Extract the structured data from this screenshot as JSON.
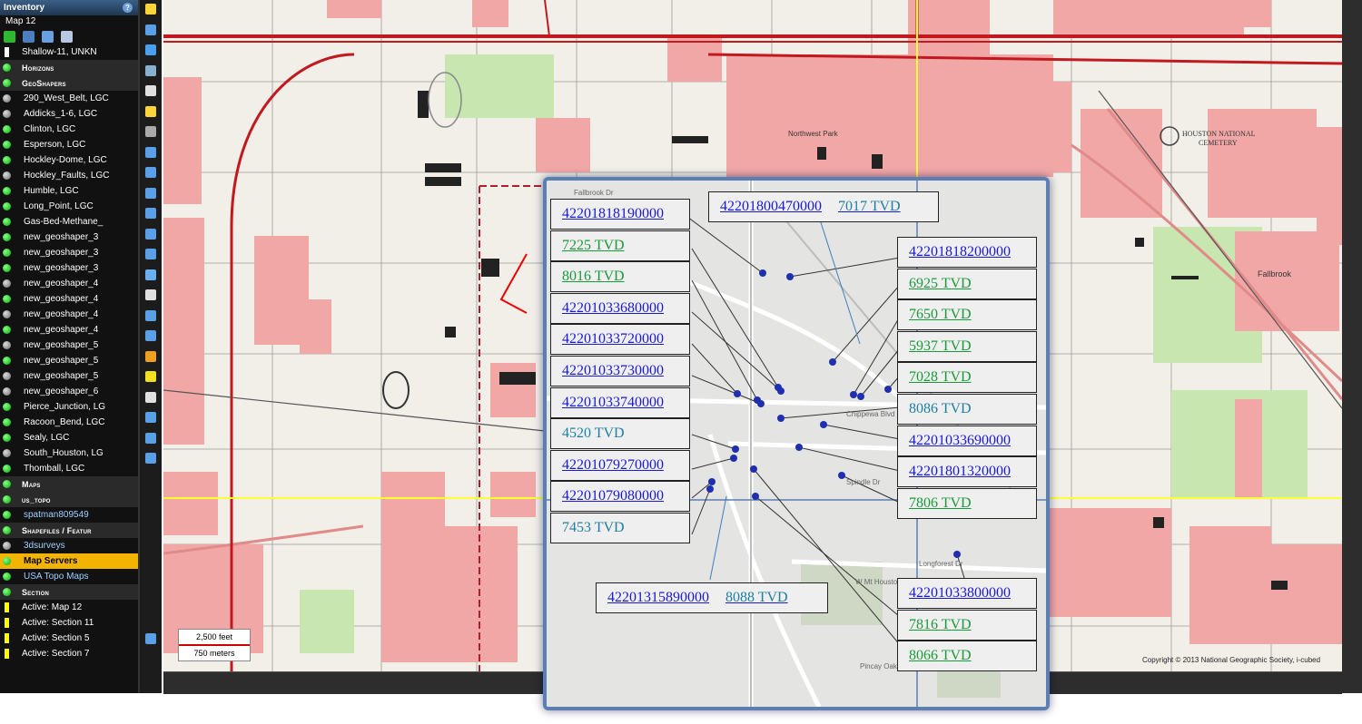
{
  "panel": {
    "title": "Inventory",
    "help_icon": "?",
    "map_name": "Map 12",
    "layers": [
      {
        "label": "Shallow-11, UNKN",
        "type": "item",
        "icon": "white"
      },
      {
        "label": "Horizons",
        "type": "group"
      },
      {
        "label": "GeoShapers",
        "type": "group"
      },
      {
        "label": "290_West_Belt, LGC",
        "type": "item",
        "icon": "gray"
      },
      {
        "label": "Addicks_1-6, LGC",
        "type": "item",
        "icon": "gray"
      },
      {
        "label": "Clinton, LGC",
        "type": "item",
        "icon": "green"
      },
      {
        "label": "Esperson, LGC",
        "type": "item",
        "icon": "green"
      },
      {
        "label": "Hockley-Dome, LGC",
        "type": "item",
        "icon": "green"
      },
      {
        "label": "Hockley_Faults, LGC",
        "type": "item",
        "icon": "gray"
      },
      {
        "label": "Humble, LGC",
        "type": "item",
        "icon": "green"
      },
      {
        "label": "Long_Point, LGC",
        "type": "item",
        "icon": "green"
      },
      {
        "label": "Gas-Bed-Methane_",
        "type": "item",
        "icon": "green"
      },
      {
        "label": "new_geoshaper_3",
        "type": "item",
        "icon": "green"
      },
      {
        "label": "new_geoshaper_3",
        "type": "item",
        "icon": "green"
      },
      {
        "label": "new_geoshaper_3",
        "type": "item",
        "icon": "green"
      },
      {
        "label": "new_geoshaper_4",
        "type": "item",
        "icon": "gray"
      },
      {
        "label": "new_geoshaper_4",
        "type": "item",
        "icon": "green"
      },
      {
        "label": "new_geoshaper_4",
        "type": "item",
        "icon": "gray"
      },
      {
        "label": "new_geoshaper_4",
        "type": "item",
        "icon": "green"
      },
      {
        "label": "new_geoshaper_5",
        "type": "item",
        "icon": "gray"
      },
      {
        "label": "new_geoshaper_5",
        "type": "item",
        "icon": "green"
      },
      {
        "label": "new_geoshaper_5",
        "type": "item",
        "icon": "gray"
      },
      {
        "label": "new_geoshaper_6",
        "type": "item",
        "icon": "gray"
      },
      {
        "label": "Pierce_Junction, LG",
        "type": "item",
        "icon": "green"
      },
      {
        "label": "Racoon_Bend, LGC",
        "type": "item",
        "icon": "green"
      },
      {
        "label": "Sealy, LGC",
        "type": "item",
        "icon": "green"
      },
      {
        "label": "South_Houston, LG",
        "type": "item",
        "icon": "gray"
      },
      {
        "label": "Thomball, LGC",
        "type": "item",
        "icon": "green"
      },
      {
        "label": "Maps",
        "type": "group"
      },
      {
        "label": "us_topo",
        "type": "group"
      },
      {
        "label": "spatman809549",
        "type": "link",
        "icon": "green"
      },
      {
        "label": "Shapefiles / Featur",
        "type": "group"
      },
      {
        "label": "3dsurveys",
        "type": "link",
        "icon": "gray"
      },
      {
        "label": "Map Servers",
        "type": "selected"
      },
      {
        "label": "USA Topo Maps",
        "type": "link",
        "icon": "green"
      },
      {
        "label": "Section",
        "type": "group"
      },
      {
        "label": "Active: Map 12",
        "type": "item",
        "icon": "yellow"
      },
      {
        "label": "Active: Section 11",
        "type": "item",
        "icon": "yellow"
      },
      {
        "label": "Active: Section 5",
        "type": "item",
        "icon": "yellow"
      },
      {
        "label": "Active: Section 7",
        "type": "item",
        "icon": "yellow"
      }
    ]
  },
  "map": {
    "labels": {
      "cemetery_1": "HOUSTON NATIONAL",
      "cemetery_2": "CEMETERY",
      "park": "Northwest Park",
      "fallbrook": "Fallbrook"
    },
    "scale": {
      "feet": "2,500 feet",
      "meters": "750 meters"
    },
    "copyright": "Copyright © 2013 National Geographic Society, i-cubed"
  },
  "inset": {
    "streets": [
      "Fallbrook Dr",
      "Chippewa Blvd",
      "Spindle Dr",
      "Longforest Dr",
      "W Mt Houston Rd",
      "Pincay Oaks"
    ],
    "left_boxes": [
      {
        "text": "42201818190000",
        "style": "api"
      },
      {
        "text": "7225  TVD",
        "style": "tvdg"
      },
      {
        "text": "8016  TVD",
        "style": "tvdg"
      },
      {
        "text": "42201033680000",
        "style": "api"
      },
      {
        "text": "42201033720000",
        "style": "api"
      },
      {
        "text": "42201033730000",
        "style": "api"
      },
      {
        "text": "42201033740000",
        "style": "api"
      },
      {
        "text": "4520  TVD",
        "style": "tvdt"
      },
      {
        "text": "42201079270000",
        "style": "api"
      },
      {
        "text": "42201079080000",
        "style": "api"
      },
      {
        "text": "7453  TVD",
        "style": "tvdt"
      }
    ],
    "right_boxes": [
      {
        "text": "42201818200000",
        "style": "api"
      },
      {
        "text": "6925  TVD",
        "style": "tvdg"
      },
      {
        "text": "7650  TVD",
        "style": "tvdg"
      },
      {
        "text": "5937  TVD",
        "style": "tvdg"
      },
      {
        "text": "7028  TVD",
        "style": "tvdg"
      },
      {
        "text": "8086  TVD",
        "style": "tvdt"
      },
      {
        "text": "42201033690000",
        "style": "api"
      },
      {
        "text": "42201801320000",
        "style": "api"
      },
      {
        "text": "7806  TVD",
        "style": "tvdg"
      }
    ],
    "right_bottom_boxes": [
      {
        "text": "42201033800000",
        "style": "api"
      },
      {
        "text": "7816  TVD",
        "style": "tvdg"
      },
      {
        "text": "8066  TVD",
        "style": "tvdg"
      }
    ],
    "top_box": {
      "api": "42201800470000",
      "tvd": "7017  TVD"
    },
    "bottom_box": {
      "api": "42201315890000",
      "tvd": "8088  TVD"
    }
  },
  "colors": {
    "urban": "#f2a7a7",
    "highway": "#c2191f",
    "api_link": "#1a1ad0",
    "tvd_green": "#1b9a3a",
    "tvd_teal": "#1e7fa2",
    "well_dot": "#1f2fae",
    "crosshair": "#ffff33"
  }
}
